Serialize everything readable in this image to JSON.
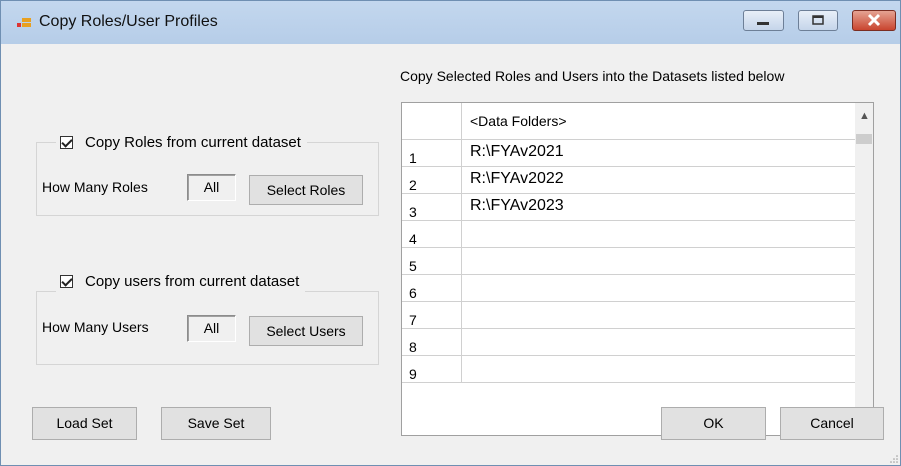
{
  "window": {
    "title": "Copy Roles/User Profiles"
  },
  "titlebar_buttons": {
    "minimize": "minimize-icon",
    "maximize": "maximize-icon",
    "close": "close-icon"
  },
  "grid_caption": "Copy Selected Roles and Users into the Datasets listed below",
  "roles": {
    "checkbox_label": "Copy Roles from current dataset",
    "checked": true,
    "how_many_label": "How Many Roles",
    "how_many_value": "All",
    "select_button": "Select Roles"
  },
  "users": {
    "checkbox_label": "Copy users from current dataset",
    "checked": true,
    "how_many_label": "How Many Users",
    "how_many_value": "All",
    "select_button": "Select Users"
  },
  "grid": {
    "column_header": "<Data Folders>",
    "rows": [
      {
        "num": "1",
        "value": "R:\\FYAv2021"
      },
      {
        "num": "2",
        "value": "R:\\FYAv2022"
      },
      {
        "num": "3",
        "value": "R:\\FYAv2023"
      },
      {
        "num": "4",
        "value": ""
      },
      {
        "num": "5",
        "value": ""
      },
      {
        "num": "6",
        "value": ""
      },
      {
        "num": "7",
        "value": ""
      },
      {
        "num": "8",
        "value": ""
      },
      {
        "num": "9",
        "value": ""
      }
    ]
  },
  "footer": {
    "load_set": "Load Set",
    "save_set": "Save Set",
    "ok": "OK",
    "cancel": "Cancel"
  }
}
